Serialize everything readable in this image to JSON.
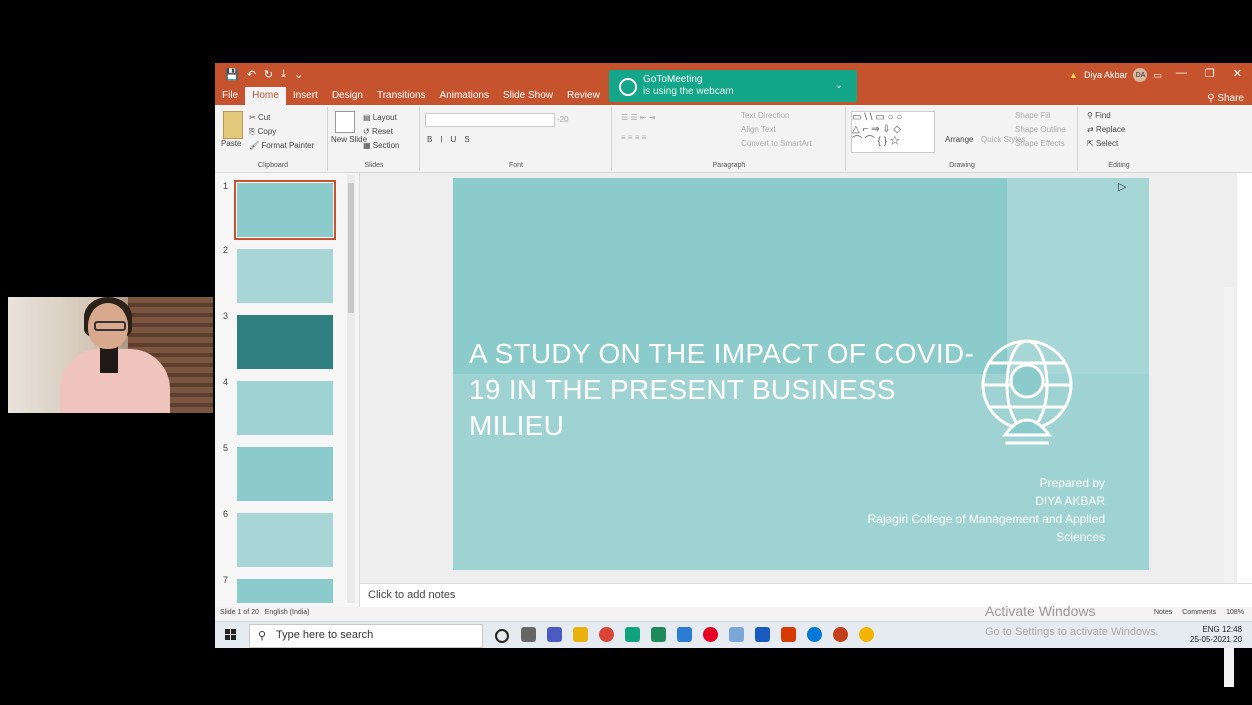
{
  "webcam": {
    "label": "presenter video feed"
  },
  "titlebar": {
    "qat": [
      "💾",
      "↶",
      "↻",
      "⤓",
      "⌄"
    ],
    "user_name": "Diya Akbar",
    "user_initials": "DA",
    "share_label": "Share"
  },
  "gotomeeting": {
    "title": "GoToMeeting",
    "subtitle": "is using the webcam"
  },
  "tabs": [
    "File",
    "Home",
    "Insert",
    "Design",
    "Transitions",
    "Animations",
    "Slide Show",
    "Review",
    "View"
  ],
  "ribbon": {
    "clipboard": {
      "label": "Clipboard",
      "paste": "Paste",
      "cut": "Cut",
      "copy": "Copy",
      "format_painter": "Format Painter"
    },
    "slides": {
      "label": "Slides",
      "new_slide": "New Slide",
      "layout": "Layout",
      "reset": "Reset",
      "section": "Section"
    },
    "font": {
      "label": "Font",
      "size": "-20"
    },
    "paragraph": {
      "label": "Paragraph",
      "text_direction": "Text Direction",
      "align_text": "Align Text",
      "smartart": "Convert to SmartArt"
    },
    "drawing": {
      "label": "Drawing",
      "arrange": "Arrange",
      "quick_styles": "Quick Styles",
      "shape_fill": "Shape Fill",
      "shape_outline": "Shape Outline",
      "shape_effects": "Shape Effects"
    },
    "editing": {
      "label": "Editing",
      "find": "Find",
      "replace": "Replace",
      "select": "Select"
    }
  },
  "thumbnails": [
    "1",
    "2",
    "3",
    "4",
    "5",
    "6",
    "7"
  ],
  "slide": {
    "title": "A STUDY ON THE IMPACT OF COVID-19 IN THE PRESENT BUSINESS MILIEU",
    "prepared_by": "Prepared by",
    "author": "DIYA AKBAR",
    "institution": "Rajagiri College of Management and Applied Sciences"
  },
  "notes": {
    "placeholder": "Click to add notes"
  },
  "status": {
    "slide_count": "Slide 1 of 20",
    "language": "English (India)",
    "notes": "Notes",
    "comments": "Comments",
    "zoom": "108%"
  },
  "watermark": {
    "line1": "Activate Windows",
    "line2": "Go to Settings to activate Windows."
  },
  "taskbar": {
    "search_placeholder": "Type here to search",
    "time": "12:48",
    "date": "25-05-2021",
    "lang": "ENG",
    "notif": "20"
  },
  "colors": {
    "accent": "#c4532e",
    "slide_bg": "#8ccbcb",
    "gtm": "#13a689"
  }
}
